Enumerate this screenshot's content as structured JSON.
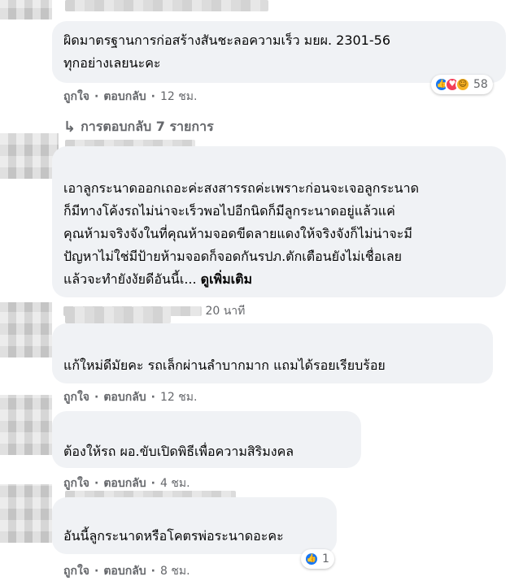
{
  "comments": [
    {
      "lines": [
        "ผิดมาตรฐานการก่อสร้างสันชะลอความเร็ว มยผ. 2301-56",
        "ทุกอย่างเลยนะคะ"
      ],
      "like_label": "ถูกใจ",
      "reply_label": "ตอบกลับ",
      "time": "12 ชม.",
      "reaction_count": "58",
      "reaction_icons": [
        "like-icon",
        "love-icon",
        "haha-icon"
      ]
    },
    {
      "lines": [
        "เอาลูกระนาดออกเถอะค่ะสงสารรถค่ะเพราะก่อนจะเจอลูกระนาด",
        "ก็มีทางโค้งรถไม่น่าจะเร็วพอไปอีกนิดก็มีลูกระนาดอยู่แล้วแค่",
        "คุณห้ามจริงจังในที่คุณห้ามจอดขีดลายแดงให้จริงจังก็ไม่น่าจะมี",
        "ปัญหาไม่ใช่มีป้ายห้ามจอดก็จอดกันรปภ.ตักเตือนยังไม่เชื่อเลย",
        "แล้วจะทำยังงัยดีอันนี้เ..."
      ],
      "see_more": "ดูเพิ่มเติม",
      "time": "20 นาที"
    },
    {
      "lines": [
        "แก้ใหม่ดีมัยคะ รถเล็กผ่านลำบากมาก แถมได้รอยเรียบร้อย"
      ],
      "like_label": "ถูกใจ",
      "reply_label": "ตอบกลับ",
      "time": "12 ชม."
    },
    {
      "lines": [
        "ต้องให้รถ ผอ.ขับเปิดพิธีเพื่อความสิริมงคล"
      ],
      "like_label": "ถูกใจ",
      "reply_label": "ตอบกลับ",
      "time": "4 ชม."
    },
    {
      "lines": [
        "อันนี้ลูกระนาดหรือโคตรพ่อระนาดอะคะ"
      ],
      "like_label": "ถูกใจ",
      "reply_label": "ตอบกลับ",
      "time": "8 ชม.",
      "reaction_count": "1",
      "reaction_icons": [
        "like-icon"
      ]
    }
  ],
  "replies": {
    "label": "การตอบกลับ 7 รายการ"
  },
  "colors": {
    "bubble": "#f0f2f5",
    "meta_text": "#65676b",
    "like": "#1877f2",
    "love": "#f33e58",
    "haha": "#f7b125"
  }
}
